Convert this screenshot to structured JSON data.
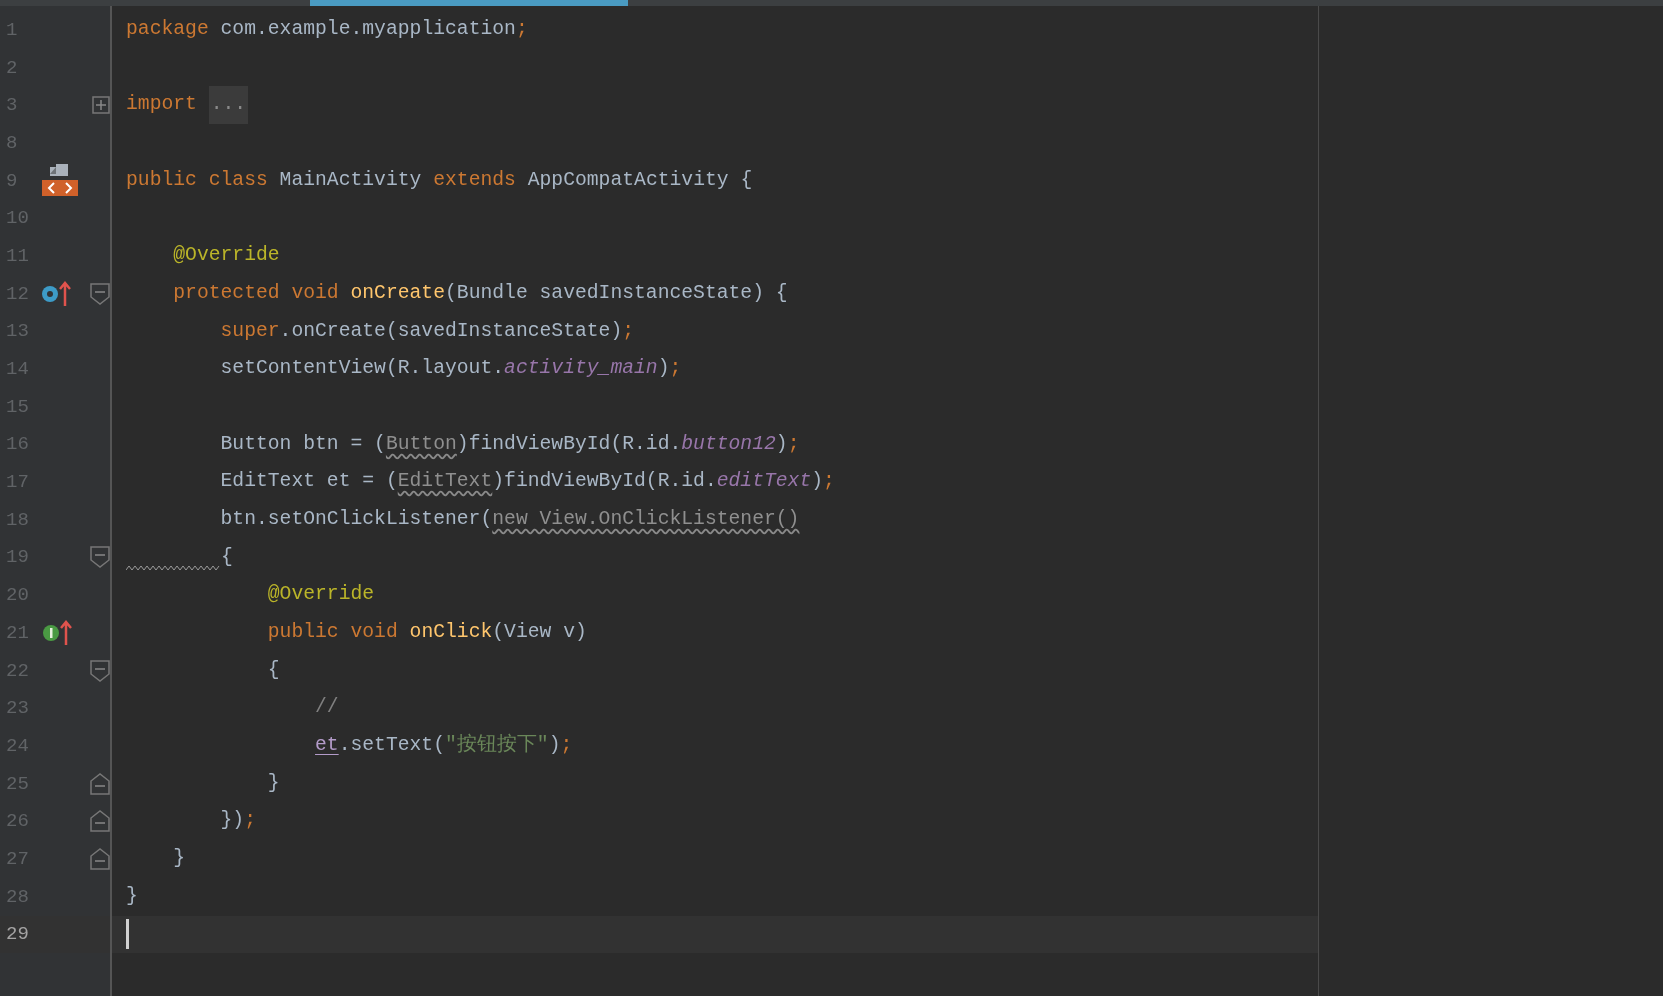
{
  "tabs": [
    {
      "selected": true
    }
  ],
  "lines": [
    {
      "number": "1",
      "tokens": [
        {
          "text": "package",
          "kind": "keyword"
        },
        {
          "text": " com.example.myapplication",
          "kind": "plain"
        },
        {
          "text": ";",
          "kind": "punct"
        }
      ]
    },
    {
      "number": "2"
    },
    {
      "number": "3",
      "fold_collapsed": true,
      "tokens": [
        {
          "text": "import ",
          "kind": "keyword"
        },
        {
          "text": "...",
          "kind": "folded"
        }
      ]
    },
    {
      "number": "8"
    },
    {
      "number": "9",
      "has_layout": true,
      "tokens": [
        {
          "text": "public class",
          "kind": "keyword"
        },
        {
          "text": " MainActivity ",
          "kind": "plain"
        },
        {
          "text": "extends",
          "kind": "keyword"
        },
        {
          "text": " AppCompatActivity {",
          "kind": "plain"
        }
      ]
    },
    {
      "number": "10"
    },
    {
      "number": "11",
      "tokens": [
        {
          "text": "    @Override",
          "kind": "annotation"
        }
      ]
    },
    {
      "number": "12",
      "overrides": true,
      "fold_open": true,
      "tokens": [
        {
          "text": "    protected void ",
          "kind": "keyword"
        },
        {
          "text": "onCreate",
          "kind": "method"
        },
        {
          "text": "(Bundle savedInstanceState) {",
          "kind": "plain"
        }
      ]
    },
    {
      "number": "13",
      "tokens": [
        {
          "text": "        super",
          "kind": "keyword"
        },
        {
          "text": ".onCreate(savedInstanceState)",
          "kind": "plain"
        },
        {
          "text": ";",
          "kind": "punct"
        }
      ]
    },
    {
      "number": "14",
      "tokens": [
        {
          "text": "        setContentView(R.layout.",
          "kind": "plain"
        },
        {
          "text": "activity_main",
          "kind": "field"
        },
        {
          "text": ")",
          "kind": "plain"
        },
        {
          "text": ";",
          "kind": "punct"
        }
      ]
    },
    {
      "number": "15"
    },
    {
      "number": "16",
      "tokens": [
        {
          "text": "        Button btn = (",
          "kind": "plain"
        },
        {
          "text": "Button",
          "kind": "warn"
        },
        {
          "text": ")findViewById(R.id.",
          "kind": "plain"
        },
        {
          "text": "button12",
          "kind": "field"
        },
        {
          "text": ")",
          "kind": "plain"
        },
        {
          "text": ";",
          "kind": "punct"
        }
      ]
    },
    {
      "number": "17",
      "tokens": [
        {
          "text": "        EditText et = (",
          "kind": "plain"
        },
        {
          "text": "EditText",
          "kind": "warn"
        },
        {
          "text": ")findViewById(R.id.",
          "kind": "plain"
        },
        {
          "text": "editText",
          "kind": "field"
        },
        {
          "text": ")",
          "kind": "plain"
        },
        {
          "text": ";",
          "kind": "punct"
        }
      ]
    },
    {
      "number": "18",
      "tokens": [
        {
          "text": "        btn.setOnClickListener(",
          "kind": "plain"
        },
        {
          "text": "new View.OnClickListener()",
          "kind": "warn"
        }
      ]
    },
    {
      "number": "19",
      "fold_open": true,
      "squiggle": true,
      "tokens": [
        {
          "text": "{",
          "kind": "plain"
        }
      ]
    },
    {
      "number": "20",
      "tokens": [
        {
          "text": "            @Override",
          "kind": "annotation"
        }
      ]
    },
    {
      "number": "21",
      "implements": true,
      "tokens": [
        {
          "text": "            public void ",
          "kind": "keyword"
        },
        {
          "text": "onClick",
          "kind": "method"
        },
        {
          "text": "(View v)",
          "kind": "plain"
        }
      ]
    },
    {
      "number": "22",
      "fold_open": true,
      "tokens": [
        {
          "text": "            {",
          "kind": "plain"
        }
      ]
    },
    {
      "number": "23",
      "tokens": [
        {
          "text": "                //",
          "kind": "comment"
        }
      ]
    },
    {
      "number": "24",
      "tokens": [
        {
          "text": "                et",
          "kind": "local"
        },
        {
          "text": ".setText(",
          "kind": "plain"
        },
        {
          "text": "\"按钮按下\"",
          "kind": "string"
        },
        {
          "text": ")",
          "kind": "plain"
        },
        {
          "text": ";",
          "kind": "punct"
        }
      ]
    },
    {
      "number": "25",
      "fold_close": true,
      "tokens": [
        {
          "text": "            }",
          "kind": "plain"
        }
      ]
    },
    {
      "number": "26",
      "fold_close": true,
      "tokens": [
        {
          "text": "        })",
          "kind": "plain"
        },
        {
          "text": ";",
          "kind": "punct"
        }
      ]
    },
    {
      "number": "27",
      "fold_close": true,
      "tokens": [
        {
          "text": "    }",
          "kind": "plain"
        }
      ]
    },
    {
      "number": "28",
      "tokens": [
        {
          "text": "}",
          "kind": "plain"
        }
      ]
    },
    {
      "number": "29",
      "selected": true
    }
  ]
}
